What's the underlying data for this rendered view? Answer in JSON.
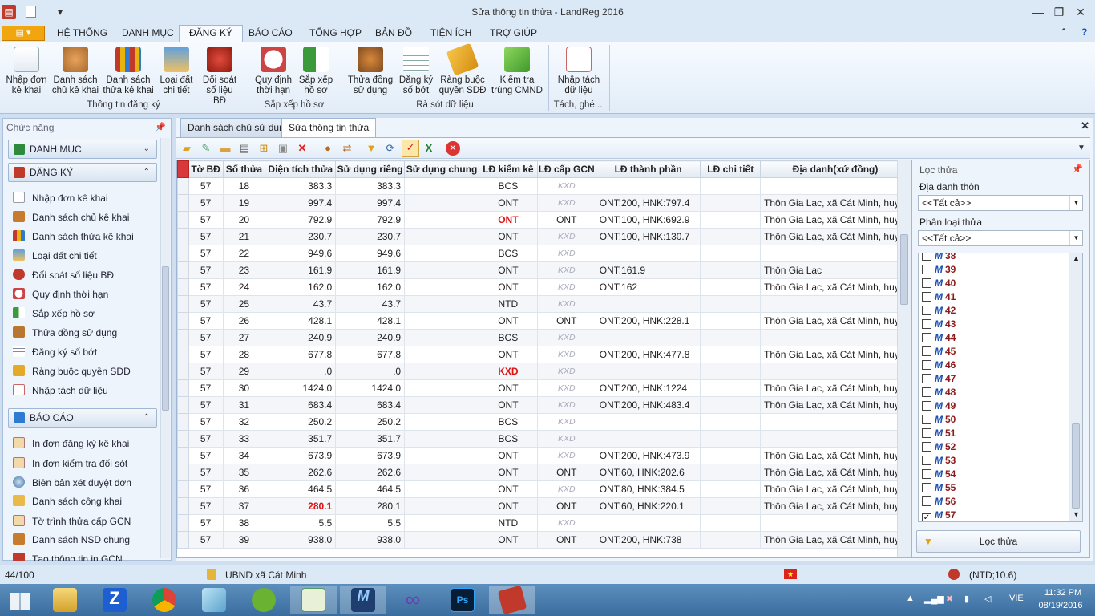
{
  "window": {
    "title": "Sửa thông tin thửa - LandReg 2016"
  },
  "ribbon_tabs": [
    "HỆ THỐNG",
    "DANH MỤC",
    "ĐĂNG KÝ",
    "BÁO CÁO",
    "TỔNG HỢP",
    "BẢN ĐỒ",
    "TIỆN ÍCH",
    "TRỢ GIÚP"
  ],
  "ribbon": {
    "g1": {
      "label": "Thông tin đăng ký",
      "b1": "Nhập đơn kê khai",
      "b2": "Danh sách chủ kê khai",
      "b3": "Danh sách thửa kê khai",
      "b4": "Loại đất chi tiết",
      "b5": "Đối soát số liệu BĐ"
    },
    "g2": {
      "label": "Sắp xếp hồ sơ",
      "b1": "Quy định thời hạn",
      "b2": "Sắp xếp hồ sơ"
    },
    "g3": {
      "label": "Rà sót dữ liệu",
      "b1": "Thửa đồng sử dụng",
      "b2": "Đăng ký số bớt",
      "b3": "Ràng buộc quyền SDĐ",
      "b4": "Kiểm tra trùng CMND"
    },
    "g4": {
      "label": "Tách, ghé...",
      "b1": "Nhập tách dữ liệu"
    }
  },
  "sidebar": {
    "title": "Chức năng",
    "cat1": "DANH MỤC",
    "cat2": "ĐĂNG KÝ",
    "dk": [
      "Nhập đơn kê khai",
      "Danh sách chủ kê khai",
      "Danh sách thửa kê khai",
      "Loại đất chi tiết",
      "Đối soát số liệu BĐ",
      "Quy định thời hạn",
      "Sắp xếp hồ sơ",
      "Thửa đồng sử dụng",
      "Đăng ký số bớt",
      "Ràng buộc quyền SDĐ",
      "Nhập tách dữ liệu"
    ],
    "cat3": "BÁO CÁO",
    "bc": [
      "In đơn đăng ký kê khai",
      "In đơn kiểm tra đối sót",
      "Biên bản xét duyệt đơn",
      "Danh sách công khai",
      "Tờ trình thửa cấp GCN",
      "Danh sách NSD chung",
      "Tạo thông tin in GCN"
    ]
  },
  "doc_tabs": [
    "Danh sách chủ sử dụng",
    "Sửa thông tin thửa"
  ],
  "grid": {
    "columns": [
      "Tờ BĐ",
      "Số thửa",
      "Diện tích thửa",
      "Sử dụng riêng",
      "Sử dụng chung",
      "LĐ kiểm kê",
      "LĐ cấp GCN",
      "LĐ thành phần",
      "LĐ chi tiết",
      "Địa danh(xứ đồng)"
    ],
    "rows": [
      [
        "57",
        "18",
        "383.3",
        "383.3",
        "",
        "BCS",
        "KXD",
        "",
        "",
        ""
      ],
      [
        "57",
        "19",
        "997.4",
        "997.4",
        "",
        "ONT",
        "KXD",
        "ONT:200, HNK:797.4",
        "",
        "Thôn Gia Lạc, xã Cát Minh, huy..."
      ],
      [
        "57",
        "20",
        "792.9",
        "792.9",
        "",
        "ONT",
        "ONT",
        "ONT:100, HNK:692.9",
        "",
        "Thôn Gia Lạc, xã Cát Minh, huy..."
      ],
      [
        "57",
        "21",
        "230.7",
        "230.7",
        "",
        "ONT",
        "KXD",
        "ONT:100, HNK:130.7",
        "",
        "Thôn Gia Lạc, xã Cát Minh, huy..."
      ],
      [
        "57",
        "22",
        "949.6",
        "949.6",
        "",
        "BCS",
        "KXD",
        "",
        "",
        ""
      ],
      [
        "57",
        "23",
        "161.9",
        "161.9",
        "",
        "ONT",
        "KXD",
        "ONT:161.9",
        "",
        "Thôn Gia Lạc"
      ],
      [
        "57",
        "24",
        "162.0",
        "162.0",
        "",
        "ONT",
        "KXD",
        "ONT:162",
        "",
        "Thôn Gia Lạc, xã Cát Minh, huy..."
      ],
      [
        "57",
        "25",
        "43.7",
        "43.7",
        "",
        "NTD",
        "KXD",
        "",
        "",
        ""
      ],
      [
        "57",
        "26",
        "428.1",
        "428.1",
        "",
        "ONT",
        "ONT",
        "ONT:200, HNK:228.1",
        "",
        "Thôn Gia Lạc, xã Cát Minh, huy..."
      ],
      [
        "57",
        "27",
        "240.9",
        "240.9",
        "",
        "BCS",
        "KXD",
        "",
        "",
        ""
      ],
      [
        "57",
        "28",
        "677.8",
        "677.8",
        "",
        "ONT",
        "KXD",
        "ONT:200, HNK:477.8",
        "",
        "Thôn Gia Lạc, xã Cát Minh, huy..."
      ],
      [
        "57",
        "29",
        ".0",
        ".0",
        "",
        "KXD",
        "KXD",
        "",
        "",
        ""
      ],
      [
        "57",
        "30",
        "1424.0",
        "1424.0",
        "",
        "ONT",
        "KXD",
        "ONT:200, HNK:1224",
        "",
        "Thôn Gia Lạc, xã Cát Minh, huy..."
      ],
      [
        "57",
        "31",
        "683.4",
        "683.4",
        "",
        "ONT",
        "KXD",
        "ONT:200, HNK:483.4",
        "",
        "Thôn Gia Lạc, xã Cát Minh, huy..."
      ],
      [
        "57",
        "32",
        "250.2",
        "250.2",
        "",
        "BCS",
        "KXD",
        "",
        "",
        ""
      ],
      [
        "57",
        "33",
        "351.7",
        "351.7",
        "",
        "BCS",
        "KXD",
        "",
        "",
        ""
      ],
      [
        "57",
        "34",
        "673.9",
        "673.9",
        "",
        "ONT",
        "KXD",
        "ONT:200, HNK:473.9",
        "",
        "Thôn Gia Lạc, xã Cát Minh, huy..."
      ],
      [
        "57",
        "35",
        "262.6",
        "262.6",
        "",
        "ONT",
        "ONT",
        "ONT:60, HNK:202.6",
        "",
        "Thôn Gia Lạc, xã Cát Minh, huy..."
      ],
      [
        "57",
        "36",
        "464.5",
        "464.5",
        "",
        "ONT",
        "KXD",
        "ONT:80, HNK:384.5",
        "",
        "Thôn Gia Lạc, xã Cát Minh, huy..."
      ],
      [
        "57",
        "37",
        "280.1",
        "280.1",
        "",
        "ONT",
        "ONT",
        "ONT:60, HNK:220.1",
        "",
        "Thôn Gia Lạc, xã Cát Minh, huy..."
      ],
      [
        "57",
        "38",
        "5.5",
        "5.5",
        "",
        "NTD",
        "KXD",
        "",
        "",
        ""
      ],
      [
        "57",
        "39",
        "938.0",
        "938.0",
        "",
        "ONT",
        "ONT",
        "ONT:200, HNK:738",
        "",
        "Thôn Gia Lạc, xã Cát Minh, huy..."
      ]
    ]
  },
  "filter": {
    "title": "Lọc thửa",
    "label1": "Địa danh thôn",
    "combo1": "<<Tất cả>>",
    "label2": "Phân loại thửa",
    "combo2": "<<Tất cả>>",
    "items": [
      "38",
      "39",
      "40",
      "41",
      "42",
      "43",
      "44",
      "45",
      "46",
      "47",
      "48",
      "49",
      "50",
      "51",
      "52",
      "53",
      "54",
      "55",
      "56",
      "57"
    ],
    "checked": "57",
    "button": "Lọc thửa"
  },
  "status": {
    "count": "44/100",
    "unit": "UBND xã Cát Minh",
    "right": "(NTD;10.6)"
  },
  "taskbar": {
    "lang": "VIE",
    "time": "11:32 PM",
    "date": "08/19/2016"
  }
}
